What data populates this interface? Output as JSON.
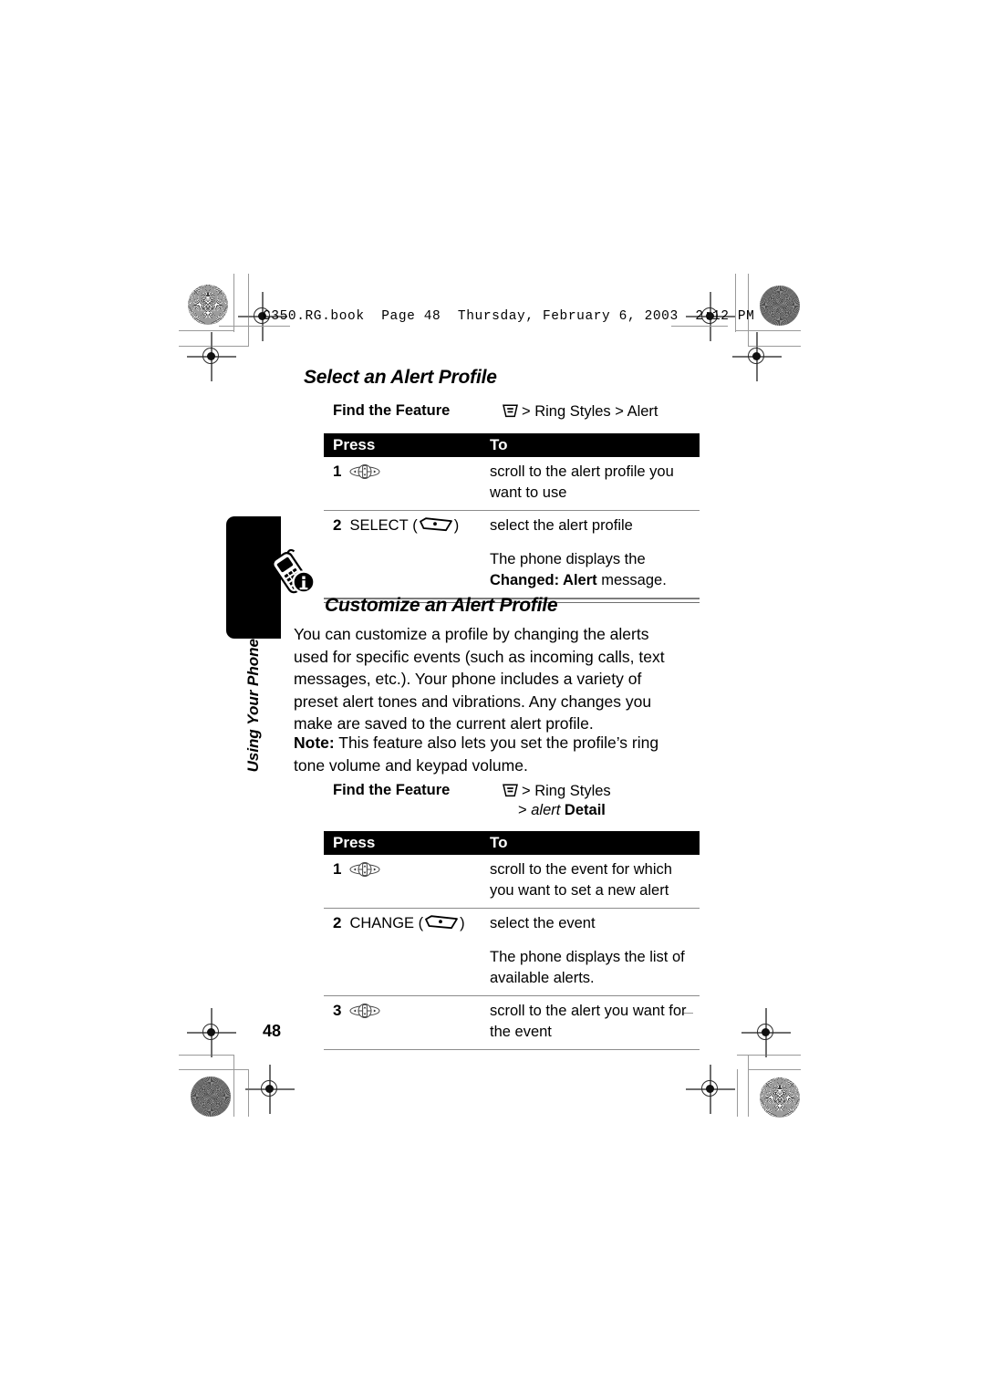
{
  "running_header": "C350.RG.book  Page 48  Thursday, February 6, 2003  2:12 PM",
  "folio": "48",
  "chapter_tab": {
    "label": "Using Your Phone",
    "icon": "phone-info-icon"
  },
  "sections": [
    {
      "title": "Select an Alert Profile",
      "find_the_feature": {
        "label": "Find the Feature",
        "icon": "menu-icon",
        "path_lines": [
          "> Ring Styles > Alert"
        ]
      },
      "table": {
        "headers": [
          "Press",
          "To"
        ],
        "rows": [
          {
            "num": "1",
            "key_icon": "nav-rocker-key-icon",
            "key_label": "",
            "to": [
              "scroll to the alert profile you want to use"
            ]
          },
          {
            "num": "2",
            "key_icon": "soft-key-icon",
            "key_label": "SELECT",
            "to": [
              "select the alert profile",
              "The phone displays the Changed: Alert message."
            ]
          }
        ]
      }
    },
    {
      "title": "Customize an Alert Profile",
      "body": [
        "You can customize a profile by changing the alerts used for specific events (such as incoming calls, text messages, etc.). Your phone includes a variety of preset alert tones and vibrations. Any changes you make are saved to the current alert profile.",
        "Note: This feature also lets you set the profile’s ring tone volume and keypad volume."
      ],
      "note_prefix": "Note:",
      "find_the_feature": {
        "label": "Find the Feature",
        "icon": "menu-icon",
        "path_lines": [
          "> Ring Styles",
          "> alert Detail"
        ]
      },
      "table": {
        "headers": [
          "Press",
          "To"
        ],
        "rows": [
          {
            "num": "1",
            "key_icon": "nav-rocker-key-icon",
            "key_label": "",
            "to": [
              "scroll to the event for which you want to set a new alert"
            ]
          },
          {
            "num": "2",
            "key_icon": "soft-key-icon",
            "key_label": "CHANGE",
            "to": [
              "select the event",
              "The phone displays the list of available alerts."
            ]
          },
          {
            "num": "3",
            "key_icon": "nav-rocker-key-icon",
            "key_label": "",
            "to": [
              "scroll to the alert you want for the event"
            ]
          }
        ]
      }
    }
  ],
  "text": {
    "title_select": "Select an Alert Profile",
    "title_customize": "Customize an Alert Profile",
    "find_the_feature_label": "Find the Feature",
    "path_1": "> Ring Styles > Alert",
    "path_2_line1": "> Ring Styles",
    "path_2_line2_italic": "alert",
    "path_2_line2_rest": " Detail",
    "path_2_line2_gt": "> ",
    "t1_head_press": "Press",
    "t1_head_to": "To",
    "t1_r1_num": "1",
    "t1_r1_to": "scroll to the alert profile you want to use",
    "t1_r2_num": "2",
    "t1_r2_key": "SELECT",
    "t1_r2_to_a": "select the alert profile",
    "t1_r2_to_b_pre": "The phone displays the ",
    "t1_r2_to_b_bold": "Changed: Alert",
    "t1_r2_to_b_post": " message.",
    "copy_1": "You can customize a profile by changing the alerts used for specific events (such as incoming calls, text messages, etc.). Your phone includes a variety of preset alert tones and vibrations. Any changes you make are saved to the current alert profile.",
    "copy_2_bold": "Note:",
    "copy_2_rest": " This feature also lets you set the profile’s ring tone volume and keypad volume.",
    "t2_head_press": "Press",
    "t2_head_to": "To",
    "t2_r1_num": "1",
    "t2_r1_to": "scroll to the event for which you want to set a new alert",
    "t2_r2_num": "2",
    "t2_r2_key": "CHANGE",
    "t2_r2_to_a": "select the event",
    "t2_r2_to_b": "The phone displays the list of available alerts.",
    "t2_r3_num": "3",
    "t2_r3_to": "scroll to the alert you want for the event",
    "chapter_label": "Using Your Phone",
    "folio": "48",
    "running_header": "C350.RG.book  Page 48  Thursday, February 6, 2003  2:12 PM"
  },
  "colors": {
    "ink": "#000000",
    "rule": "#8c8c8c",
    "press_mark": "#9a9a9a",
    "paper": "#ffffff"
  }
}
